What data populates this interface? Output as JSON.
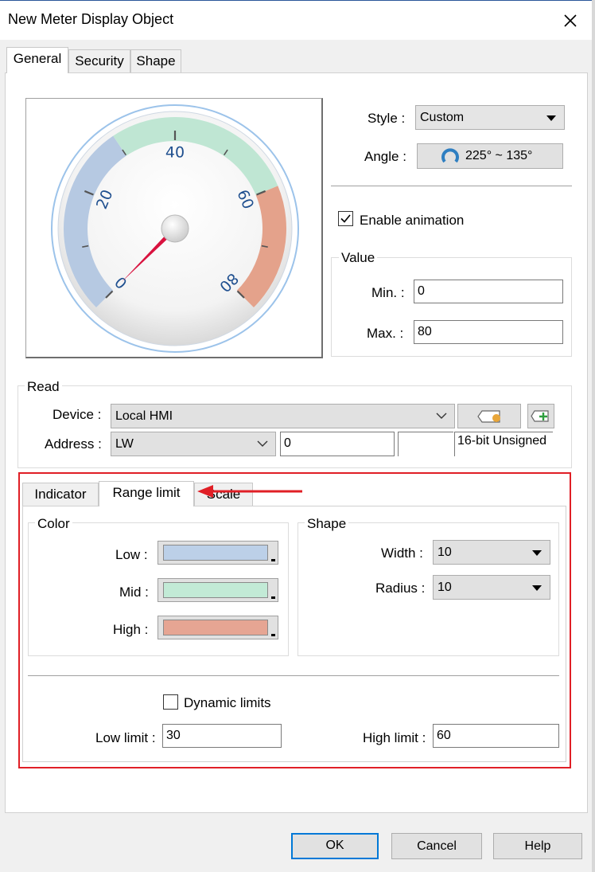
{
  "window": {
    "title": "New Meter Display Object"
  },
  "tabs": [
    "General",
    "Security",
    "Shape"
  ],
  "gauge": {
    "ticks": [
      "0",
      "20",
      "40",
      "60",
      "80"
    ],
    "value_fraction": 0.0,
    "range_colors": {
      "low": "#b6c9e2",
      "mid": "#bfe6d3",
      "high": "#e4a28b"
    }
  },
  "style": {
    "label": "Style :",
    "value": "Custom"
  },
  "angle": {
    "label": "Angle :",
    "value": "225° ~ 135°"
  },
  "animation": {
    "label": "Enable animation",
    "checked": true
  },
  "value_group": {
    "title": "Value",
    "min_label": "Min. :",
    "min": "0",
    "max_label": "Max. :",
    "max": "80"
  },
  "read": {
    "title": "Read",
    "device_label": "Device :",
    "device": "Local HMI",
    "address_label": "Address :",
    "address_type": "LW",
    "address": "0",
    "data_type": "16-bit Unsigned"
  },
  "subtabs": [
    "Indicator",
    "Range limit",
    "Scale"
  ],
  "color_group": {
    "title": "Color",
    "low_label": "Low :",
    "mid_label": "Mid :",
    "high_label": "High :",
    "low_color": "#bcd0e8",
    "mid_color": "#c2ead6",
    "high_color": "#e6a593"
  },
  "shape_group": {
    "title": "Shape",
    "width_label": "Width :",
    "width": "10",
    "radius_label": "Radius :",
    "radius": "10"
  },
  "dynamic": {
    "label": "Dynamic limits",
    "checked": false
  },
  "limits": {
    "low_label": "Low limit :",
    "low": "30",
    "high_label": "High limit :",
    "high": "60"
  },
  "buttons": {
    "ok": "OK",
    "cancel": "Cancel",
    "help": "Help"
  },
  "accent": {
    "highlight_red": "#e01f26",
    "focus_blue": "#0078d7"
  }
}
